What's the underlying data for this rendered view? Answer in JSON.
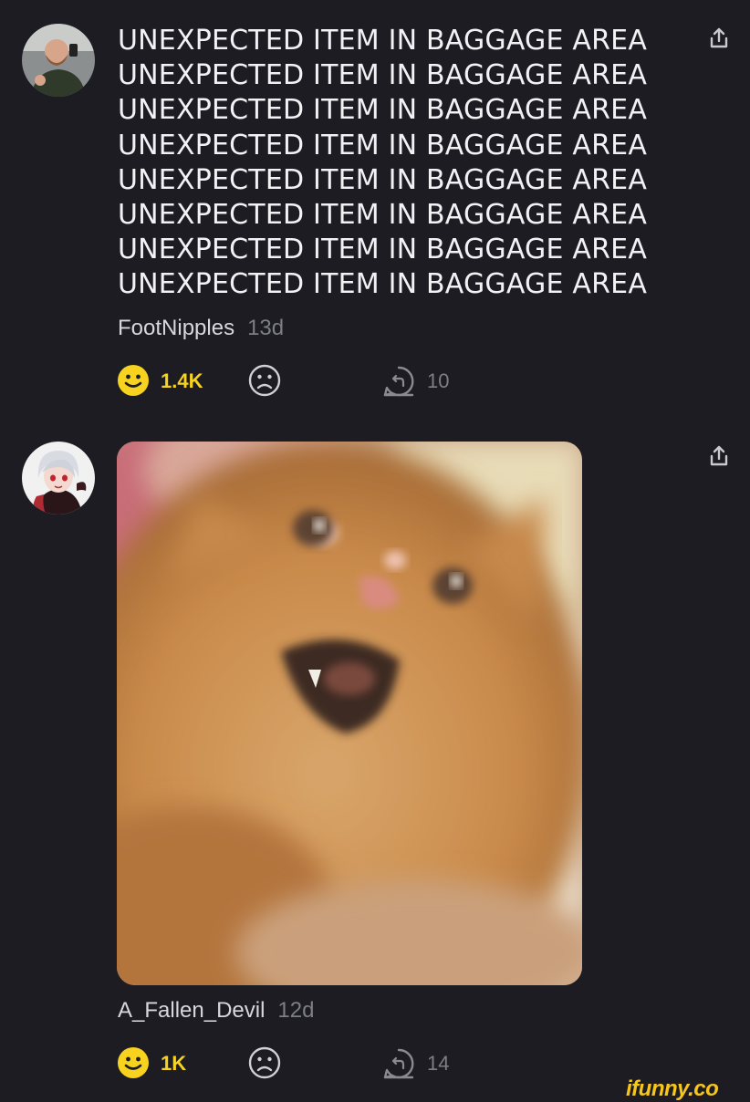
{
  "comments": [
    {
      "lines": [
        "UNEXPECTED ITEM IN BAGGAGE AREA",
        "UNEXPECTED ITEM IN BAGGAGE AREA",
        "UNEXPECTED ITEM IN BAGGAGE AREA",
        "UNEXPECTED ITEM IN BAGGAGE AREA",
        "UNEXPECTED ITEM IN BAGGAGE AREA",
        "UNEXPECTED ITEM IN BAGGAGE AREA",
        "UNEXPECTED ITEM IN BAGGAGE AREA",
        "UNEXPECTED ITEM IN BAGGAGE AREA"
      ],
      "username": "FootNipples",
      "time": "13d",
      "smiles": "1.4K",
      "replies": "10"
    },
    {
      "username": "A_Fallen_Devil",
      "time": "12d",
      "smiles": "1K",
      "replies": "14"
    }
  ],
  "watermark": "ifunny.co",
  "colors": {
    "background": "#1c1c22",
    "smile_yellow": "#f7d21e",
    "muted": "#7e7e86"
  },
  "icons": [
    "share-icon",
    "smile-icon",
    "unsmile-icon",
    "reply-icon"
  ]
}
